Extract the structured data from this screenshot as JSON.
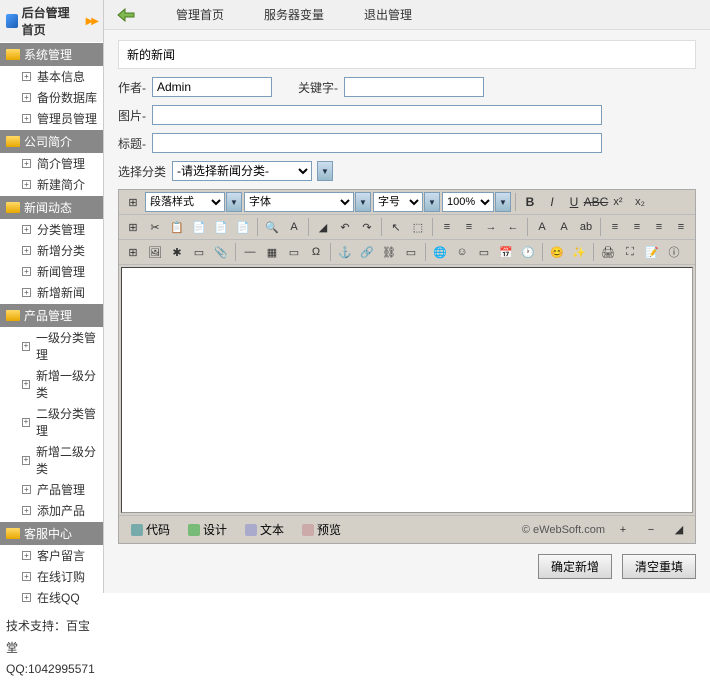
{
  "sidebar": {
    "title": "后台管理首页",
    "sections": [
      {
        "label": "系统管理",
        "items": [
          "基本信息",
          "备份数据库",
          "管理员管理"
        ]
      },
      {
        "label": "公司简介",
        "items": [
          "简介管理",
          "新建简介"
        ]
      },
      {
        "label": "新闻动态",
        "items": [
          "分类管理",
          "新增分类",
          "新闻管理",
          "新增新闻"
        ]
      },
      {
        "label": "产品管理",
        "items": [
          "一级分类管理",
          "新增一级分类",
          "二级分类管理",
          "新增二级分类",
          "产品管理",
          "添加产品"
        ]
      },
      {
        "label": "客服中心",
        "items": [
          "客户留言",
          "在线订购",
          "在线QQ"
        ]
      }
    ],
    "tech_line": "技术支持：百宝堂",
    "qq_line": "QQ:1042995571"
  },
  "topnav": {
    "home": "管理首页",
    "server": "服务器变量",
    "exit": "退出管理"
  },
  "panel": {
    "title": "新的新闻",
    "author_label": "作者-",
    "author_value": "Admin",
    "keyword_label": "关键字-",
    "image_label": "图片-",
    "title_label": "标题-",
    "category_label": "选择分类",
    "category_placeholder": "-请选择新闻分类-"
  },
  "editor": {
    "para_style": "段落样式",
    "font": "字体",
    "size": "字号",
    "zoom": "100%",
    "modes": {
      "code": "代码",
      "design": "设计",
      "text": "文本",
      "preview": "预览"
    },
    "copyright": "© eWebSoft.com"
  },
  "actions": {
    "submit": "确定新增",
    "reset": "清空重填"
  }
}
